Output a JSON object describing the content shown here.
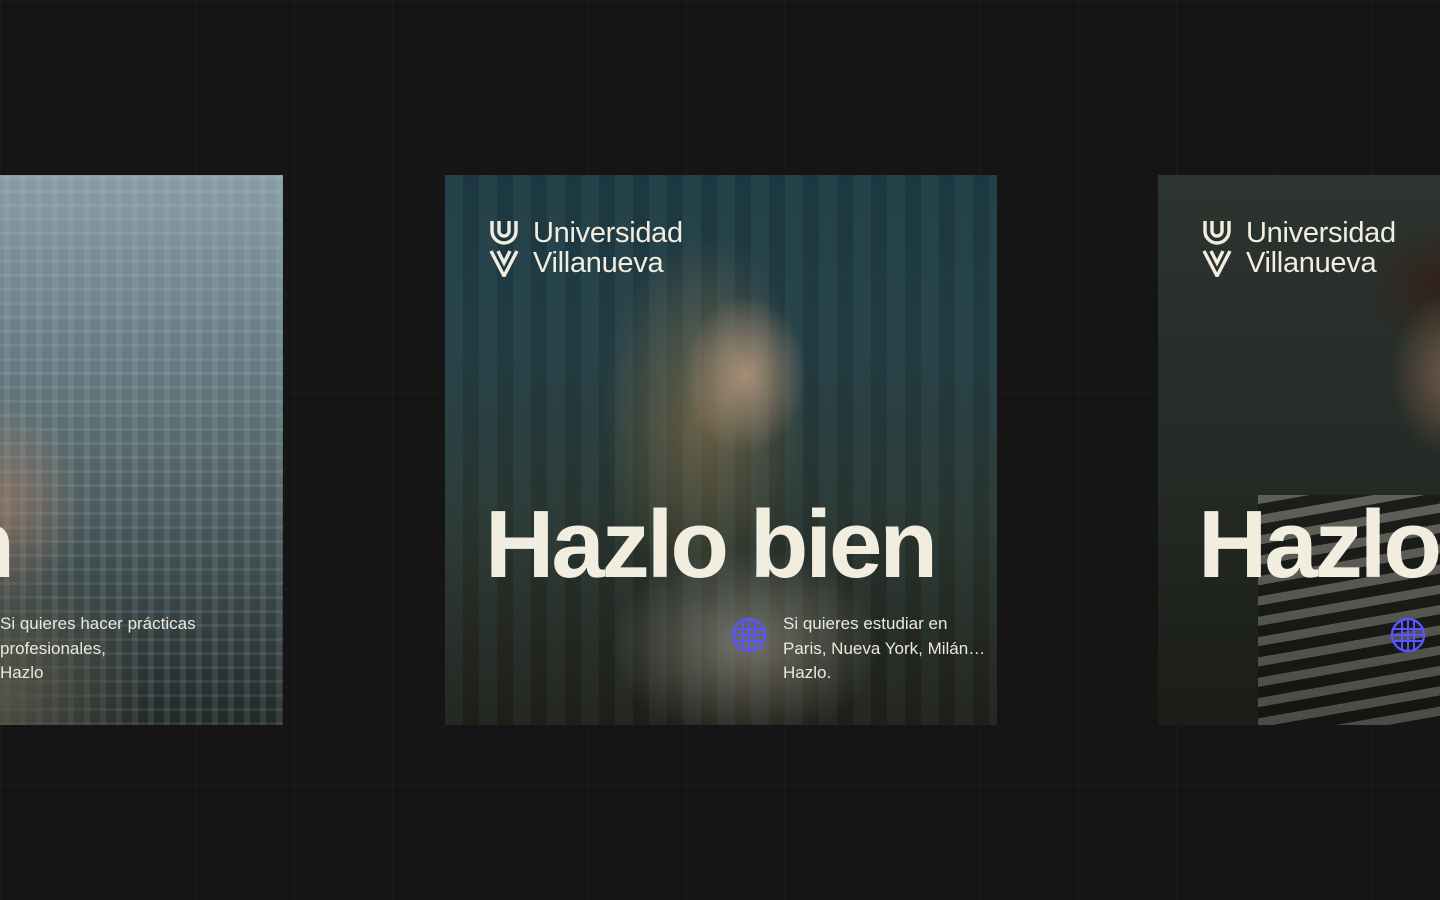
{
  "brand": {
    "line1": "Universidad",
    "line2": "Villanueva"
  },
  "cards": [
    {
      "headline": "Hazlo bien",
      "caption": [
        "Si quieres hacer prácticas",
        "profesionales,",
        "Hazlo"
      ]
    },
    {
      "headline": "Hazlo bien",
      "caption": [
        "Si quieres estudiar en",
        "Paris, Nueva York, Milán…",
        "Hazlo."
      ]
    },
    {
      "headline": "Hazlo",
      "caption": []
    }
  ],
  "icons": {
    "logo": "universidad-villanueva-logo-icon",
    "caption": "globe-icon"
  },
  "colors": {
    "background": "#151515",
    "text_cream": "#f1eddf",
    "icon_accent": "#5a54ff"
  }
}
